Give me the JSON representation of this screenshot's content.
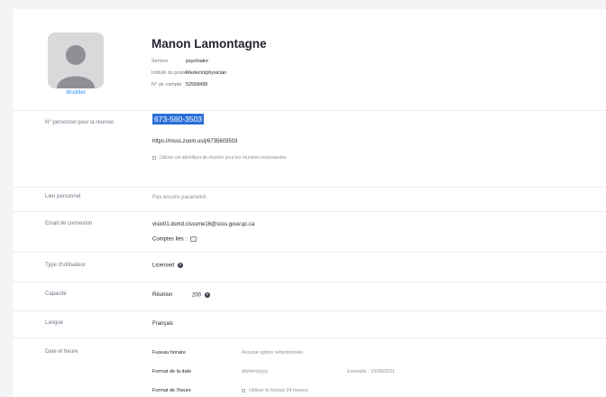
{
  "profile": {
    "name": "Manon Lamontagne",
    "edit_label": "Modifier",
    "fields": [
      {
        "label": "Service",
        "value": "psychiatre"
      },
      {
        "label": "Intitulé du poste",
        "value": "Medecin/physician"
      },
      {
        "label": "N° de compte",
        "value": "52558495"
      }
    ]
  },
  "pmi": {
    "label": "N° personnel pour la réunion",
    "number": "673-560-3503",
    "url": "https://msss.zoom.us/j/6735603503",
    "checkbox_label": "Utiliser cet identifiant de réunion pour les réunions instantanées"
  },
  "personal_link": {
    "label": "Lien personnel",
    "value": "Pas encore paramétré."
  },
  "login_email": {
    "label": "Email de connexion",
    "value": "visio01.dsmd.cisssme16@ssss.gouv.qc.ca",
    "linked_label": "Comptes liés :"
  },
  "user_type": {
    "label": "Type d'utilisateur",
    "value": "Licensed"
  },
  "capacity": {
    "label": "Capacité",
    "meeting_label": "Réunion",
    "meeting_value": "200"
  },
  "language": {
    "label": "Langue",
    "value": "Français"
  },
  "datetime": {
    "label": "Date et heure",
    "timezone_label": "Fuseau horaire",
    "timezone_value": "Aucune option sélectionnée.",
    "date_format_label": "Format de la date",
    "date_format_value": "dd/mm/yyyy",
    "date_example": "Exemple : 15/08/2011",
    "time_format_label": "Format de l'heure",
    "time_format_checkbox": "Utiliser le format 24 heures"
  },
  "icons": {
    "help": "help-icon",
    "linked": "linked-accounts-icon",
    "avatar": "avatar-placeholder-icon"
  },
  "colors": {
    "accent": "#2d8cff",
    "highlight": "#2b6fd8",
    "text": "#232333",
    "muted": "#747487"
  }
}
